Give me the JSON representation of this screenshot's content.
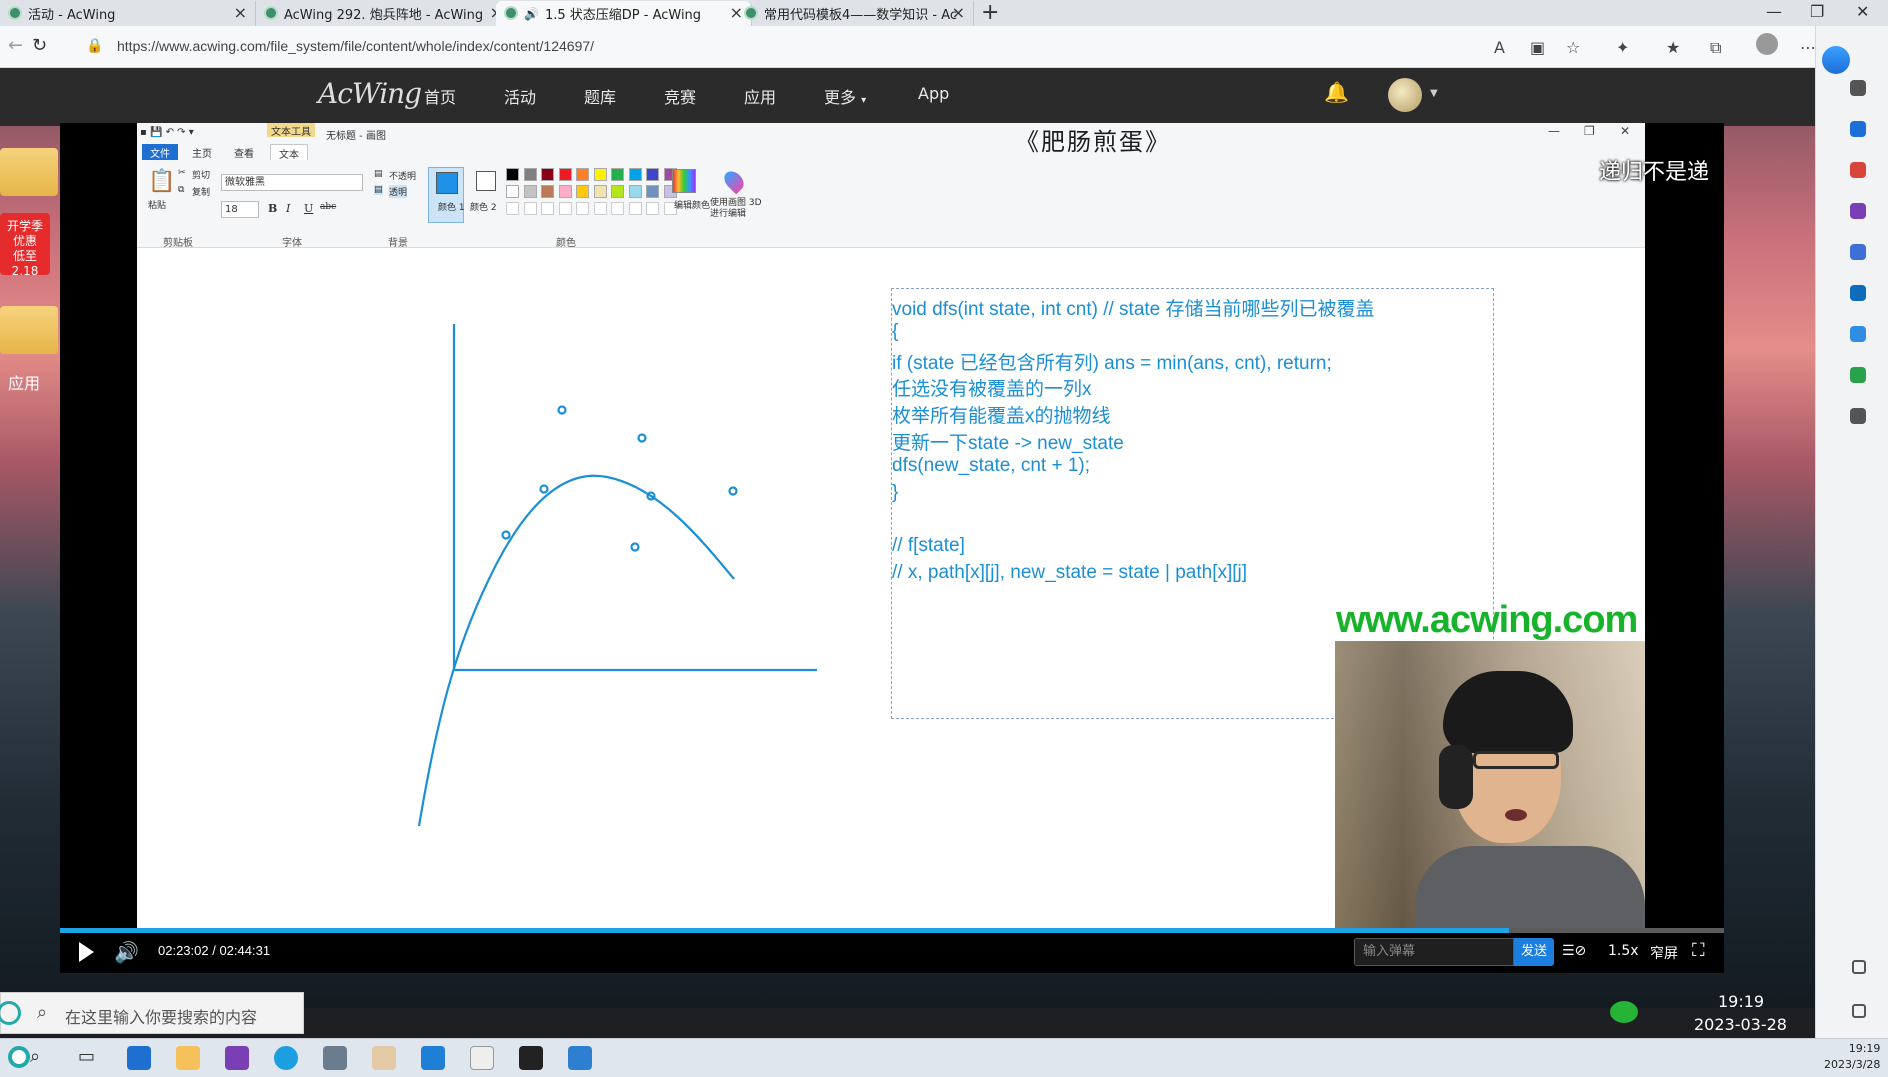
{
  "browser": {
    "tabs": [
      {
        "title": "活动 - AcWing"
      },
      {
        "title": "AcWing 292. 炮兵阵地 - AcWing"
      },
      {
        "title": "1.5 状态压缩DP - AcWing"
      },
      {
        "title": "常用代码模板4——数学知识 - Ac"
      }
    ],
    "url": "https://www.acwing.com/file_system/file/content/whole/index/content/124697/"
  },
  "site": {
    "logo": "AcWing",
    "nav": [
      "首页",
      "活动",
      "题库",
      "竞赛",
      "应用",
      "更多",
      "App"
    ]
  },
  "desktop": {
    "promo": [
      "开学季",
      "优惠",
      "低至2.18"
    ],
    "apps_label": "应用"
  },
  "paint": {
    "title": "无标题 - 画图",
    "text_tools_label": "文本工具",
    "tabs": [
      "文件",
      "主页",
      "查看",
      "文本"
    ],
    "clipboard": {
      "paste": "粘贴",
      "cut": "剪切",
      "copy": "复制",
      "label": "剪贴板"
    },
    "font": {
      "family": "微软雅黑",
      "size": "18",
      "label": "字体"
    },
    "background": {
      "opaque": "不透明",
      "transparent": "透明",
      "label": "背景"
    },
    "colors": {
      "color1": "颜色 1",
      "color2": "颜色 2",
      "edit": "编辑颜色",
      "paint3d": "使用画图 3D 进行编辑",
      "label": "颜色"
    },
    "palette": [
      "#000000",
      "#7f7f7f",
      "#880015",
      "#ed1c24",
      "#ff7f27",
      "#fff200",
      "#22b14c",
      "#00a2e8",
      "#3f48cc",
      "#a349a4",
      "#ffffff",
      "#c3c3c3",
      "#b97a57",
      "#ffaec9",
      "#ffc90e",
      "#efe4b0",
      "#b5e61d",
      "#99d9ea",
      "#7092be",
      "#c8bfe7"
    ]
  },
  "video_overlay": {
    "title_watermark": "《肥肠煎蛋》",
    "danmaku": "递归不是递",
    "site_watermark": "www.acwing.com"
  },
  "code": [
    "void  dfs(int state, int cnt) // state 存储当前哪些列已被覆盖",
    "{",
    "  if (state 已经包含所有列) ans = min(ans, cnt), return;",
    "  任选没有被覆盖的一列x",
    "  枚举所有能覆盖x的抛物线",
    "     更新一下state -> new_state",
    "     dfs(new_state, cnt + 1);",
    "}",
    "",
    "// f[state]",
    "// x, path[x][j], new_state = state | path[x][j]"
  ],
  "player": {
    "time": "02:23:02 / 02:44:31",
    "progress": 0.871,
    "danmaku_placeholder": "输入弹幕",
    "send": "发送",
    "speed": "1.5x",
    "narrow": "窄屏"
  },
  "taskbar": {
    "search_placeholder": "在这里输入你要搜索的内容",
    "clock_time": "19:19",
    "clock_date": "2023-03-28",
    "tray_time": "19:19",
    "tray_date": "2023/3/28"
  }
}
